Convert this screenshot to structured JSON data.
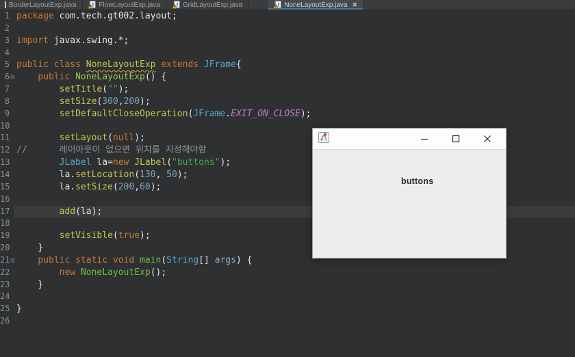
{
  "colors": {
    "editor_bg": "#2F3032",
    "tabbar_bg": "#3A3C3E",
    "tab_active_bg": "#47494B",
    "tab_active_underline": "#3F76A8",
    "tab_text": "#9FA3A6",
    "tab_text_active": "#CFD2D4",
    "gutter_text": "#8A9193",
    "current_line_bg": "#3B3C3D",
    "kw": "#CB7832",
    "method": "#C6C84F",
    "classref": "#55A6C9",
    "string": "#43AC4D",
    "number": "#7BA3BF",
    "constant": "#BE7BC8",
    "comment": "#8A9494",
    "plain": "#E6E6E6",
    "decl_green": "#6CBE44",
    "ctor_decl": "#9DC74F",
    "param": "#87AEC7",
    "warning": "#D9A94A",
    "win_titlebar": "#FDFDFD",
    "win_body": "#EDEDEE",
    "win_border": "#9E9E9E",
    "win_label": "#2B2B2B"
  },
  "tabbar": {
    "tabs": [
      {
        "label": "BorderLayoutExp.java",
        "active": false,
        "icon": "java-file-warning-icon",
        "clipped_icon": true
      },
      {
        "label": "FlowLayoutExp.java",
        "active": false,
        "icon": "java-file-warning-icon"
      },
      {
        "label": "GridLayoutExp.java",
        "active": false,
        "icon": "java-file-warning-icon"
      },
      {
        "label": "NoneLayoutExp.java",
        "active": true,
        "icon": "java-file-warning-icon",
        "close_glyph": "✕"
      }
    ]
  },
  "editor": {
    "lines": [
      {
        "n": "1",
        "tk": [
          [
            "kw",
            "package"
          ],
          [
            "pl",
            " com.tech.gt002.layout;"
          ]
        ]
      },
      {
        "n": "2",
        "tk": []
      },
      {
        "n": "3",
        "tk": [
          [
            "kw",
            "import"
          ],
          [
            "pl",
            " javax.swing.*;"
          ]
        ]
      },
      {
        "n": "4",
        "tk": []
      },
      {
        "n": "5",
        "tk": [
          [
            "kw",
            "public class"
          ],
          [
            "pl",
            " "
          ],
          [
            "classdecl",
            "NoneLayoutExp"
          ],
          [
            "pl",
            " "
          ],
          [
            "kw",
            "extends"
          ],
          [
            "pl",
            " "
          ],
          [
            "classref",
            "JFrame"
          ],
          [
            "pl",
            "{"
          ]
        ]
      },
      {
        "n": "6",
        "fold": true,
        "tk": [
          [
            "pl",
            "    "
          ],
          [
            "kw",
            "public"
          ],
          [
            "pl",
            " "
          ],
          [
            "ctordecl",
            "NoneLayoutExp"
          ],
          [
            "pl",
            "() {"
          ]
        ]
      },
      {
        "n": "7",
        "tk": [
          [
            "pl",
            "        "
          ],
          [
            "method",
            "setTitle"
          ],
          [
            "pl",
            "("
          ],
          [
            "string",
            "\"\""
          ],
          [
            "pl",
            ");"
          ]
        ]
      },
      {
        "n": "8",
        "tk": [
          [
            "pl",
            "        "
          ],
          [
            "method",
            "setSize"
          ],
          [
            "pl",
            "("
          ],
          [
            "number",
            "300"
          ],
          [
            "pl",
            ","
          ],
          [
            "number",
            "200"
          ],
          [
            "pl",
            ");"
          ]
        ]
      },
      {
        "n": "9",
        "tk": [
          [
            "pl",
            "        "
          ],
          [
            "method",
            "setDefaultCloseOperation"
          ],
          [
            "pl",
            "("
          ],
          [
            "classref",
            "JFrame"
          ],
          [
            "pl",
            "."
          ],
          [
            "const",
            "EXIT_ON_CLOSE"
          ],
          [
            "pl",
            ");"
          ]
        ]
      },
      {
        "n": "10",
        "tk": []
      },
      {
        "n": "11",
        "tk": [
          [
            "pl",
            "        "
          ],
          [
            "method",
            "setLayout"
          ],
          [
            "pl",
            "("
          ],
          [
            "kw",
            "null"
          ],
          [
            "pl",
            ");"
          ]
        ]
      },
      {
        "n": "12",
        "tk": [
          [
            "comment",
            "//      레이아웃이 없으면 위치를 지정해야함"
          ]
        ]
      },
      {
        "n": "13",
        "tk": [
          [
            "pl",
            "        "
          ],
          [
            "classref",
            "JLabel"
          ],
          [
            "pl",
            " la="
          ],
          [
            "kw",
            "new"
          ],
          [
            "pl",
            " "
          ],
          [
            "method",
            "JLabel"
          ],
          [
            "pl",
            "("
          ],
          [
            "string",
            "\"buttons\""
          ],
          [
            "pl",
            ");"
          ]
        ]
      },
      {
        "n": "14",
        "tk": [
          [
            "pl",
            "        la."
          ],
          [
            "method",
            "setLocation"
          ],
          [
            "pl",
            "("
          ],
          [
            "number",
            "130"
          ],
          [
            "pl",
            ", "
          ],
          [
            "number",
            "50"
          ],
          [
            "pl",
            ");"
          ]
        ]
      },
      {
        "n": "15",
        "tk": [
          [
            "pl",
            "        la."
          ],
          [
            "method",
            "setSize"
          ],
          [
            "pl",
            "("
          ],
          [
            "number",
            "200"
          ],
          [
            "pl",
            ","
          ],
          [
            "number",
            "60"
          ],
          [
            "pl",
            ");"
          ]
        ]
      },
      {
        "n": "16",
        "tk": []
      },
      {
        "n": "17",
        "cur": true,
        "tk": [
          [
            "pl",
            "        "
          ],
          [
            "method",
            "add"
          ],
          [
            "pl",
            "(la);"
          ]
        ]
      },
      {
        "n": "18",
        "tk": []
      },
      {
        "n": "19",
        "tk": [
          [
            "pl",
            "        "
          ],
          [
            "method",
            "setVisible"
          ],
          [
            "pl",
            "("
          ],
          [
            "kw",
            "true"
          ],
          [
            "pl",
            ");"
          ]
        ]
      },
      {
        "n": "20",
        "tk": [
          [
            "pl",
            "    }"
          ]
        ]
      },
      {
        "n": "21",
        "fold": true,
        "tk": [
          [
            "pl",
            "    "
          ],
          [
            "kw",
            "public static void"
          ],
          [
            "pl",
            " "
          ],
          [
            "declgreen",
            "main"
          ],
          [
            "pl",
            "("
          ],
          [
            "classref",
            "String"
          ],
          [
            "pl",
            "[] "
          ],
          [
            "param",
            "args"
          ],
          [
            "pl",
            ") {"
          ]
        ]
      },
      {
        "n": "22",
        "tk": [
          [
            "pl",
            "        "
          ],
          [
            "kw",
            "new"
          ],
          [
            "pl",
            " "
          ],
          [
            "declgreen",
            "NoneLayoutExp"
          ],
          [
            "pl",
            "();"
          ]
        ]
      },
      {
        "n": "23",
        "tk": [
          [
            "pl",
            "    }"
          ]
        ]
      },
      {
        "n": "24",
        "tk": []
      },
      {
        "n": "25",
        "tk": [
          [
            "pl",
            "}"
          ]
        ]
      },
      {
        "n": "26",
        "tk": []
      }
    ]
  },
  "app_window": {
    "title": "",
    "icon": "java-duke-icon",
    "controls": [
      {
        "name": "minimize",
        "glyph": "—"
      },
      {
        "name": "maximize",
        "glyph": "□"
      },
      {
        "name": "close",
        "glyph": "✕"
      }
    ],
    "content_label": "buttons"
  }
}
